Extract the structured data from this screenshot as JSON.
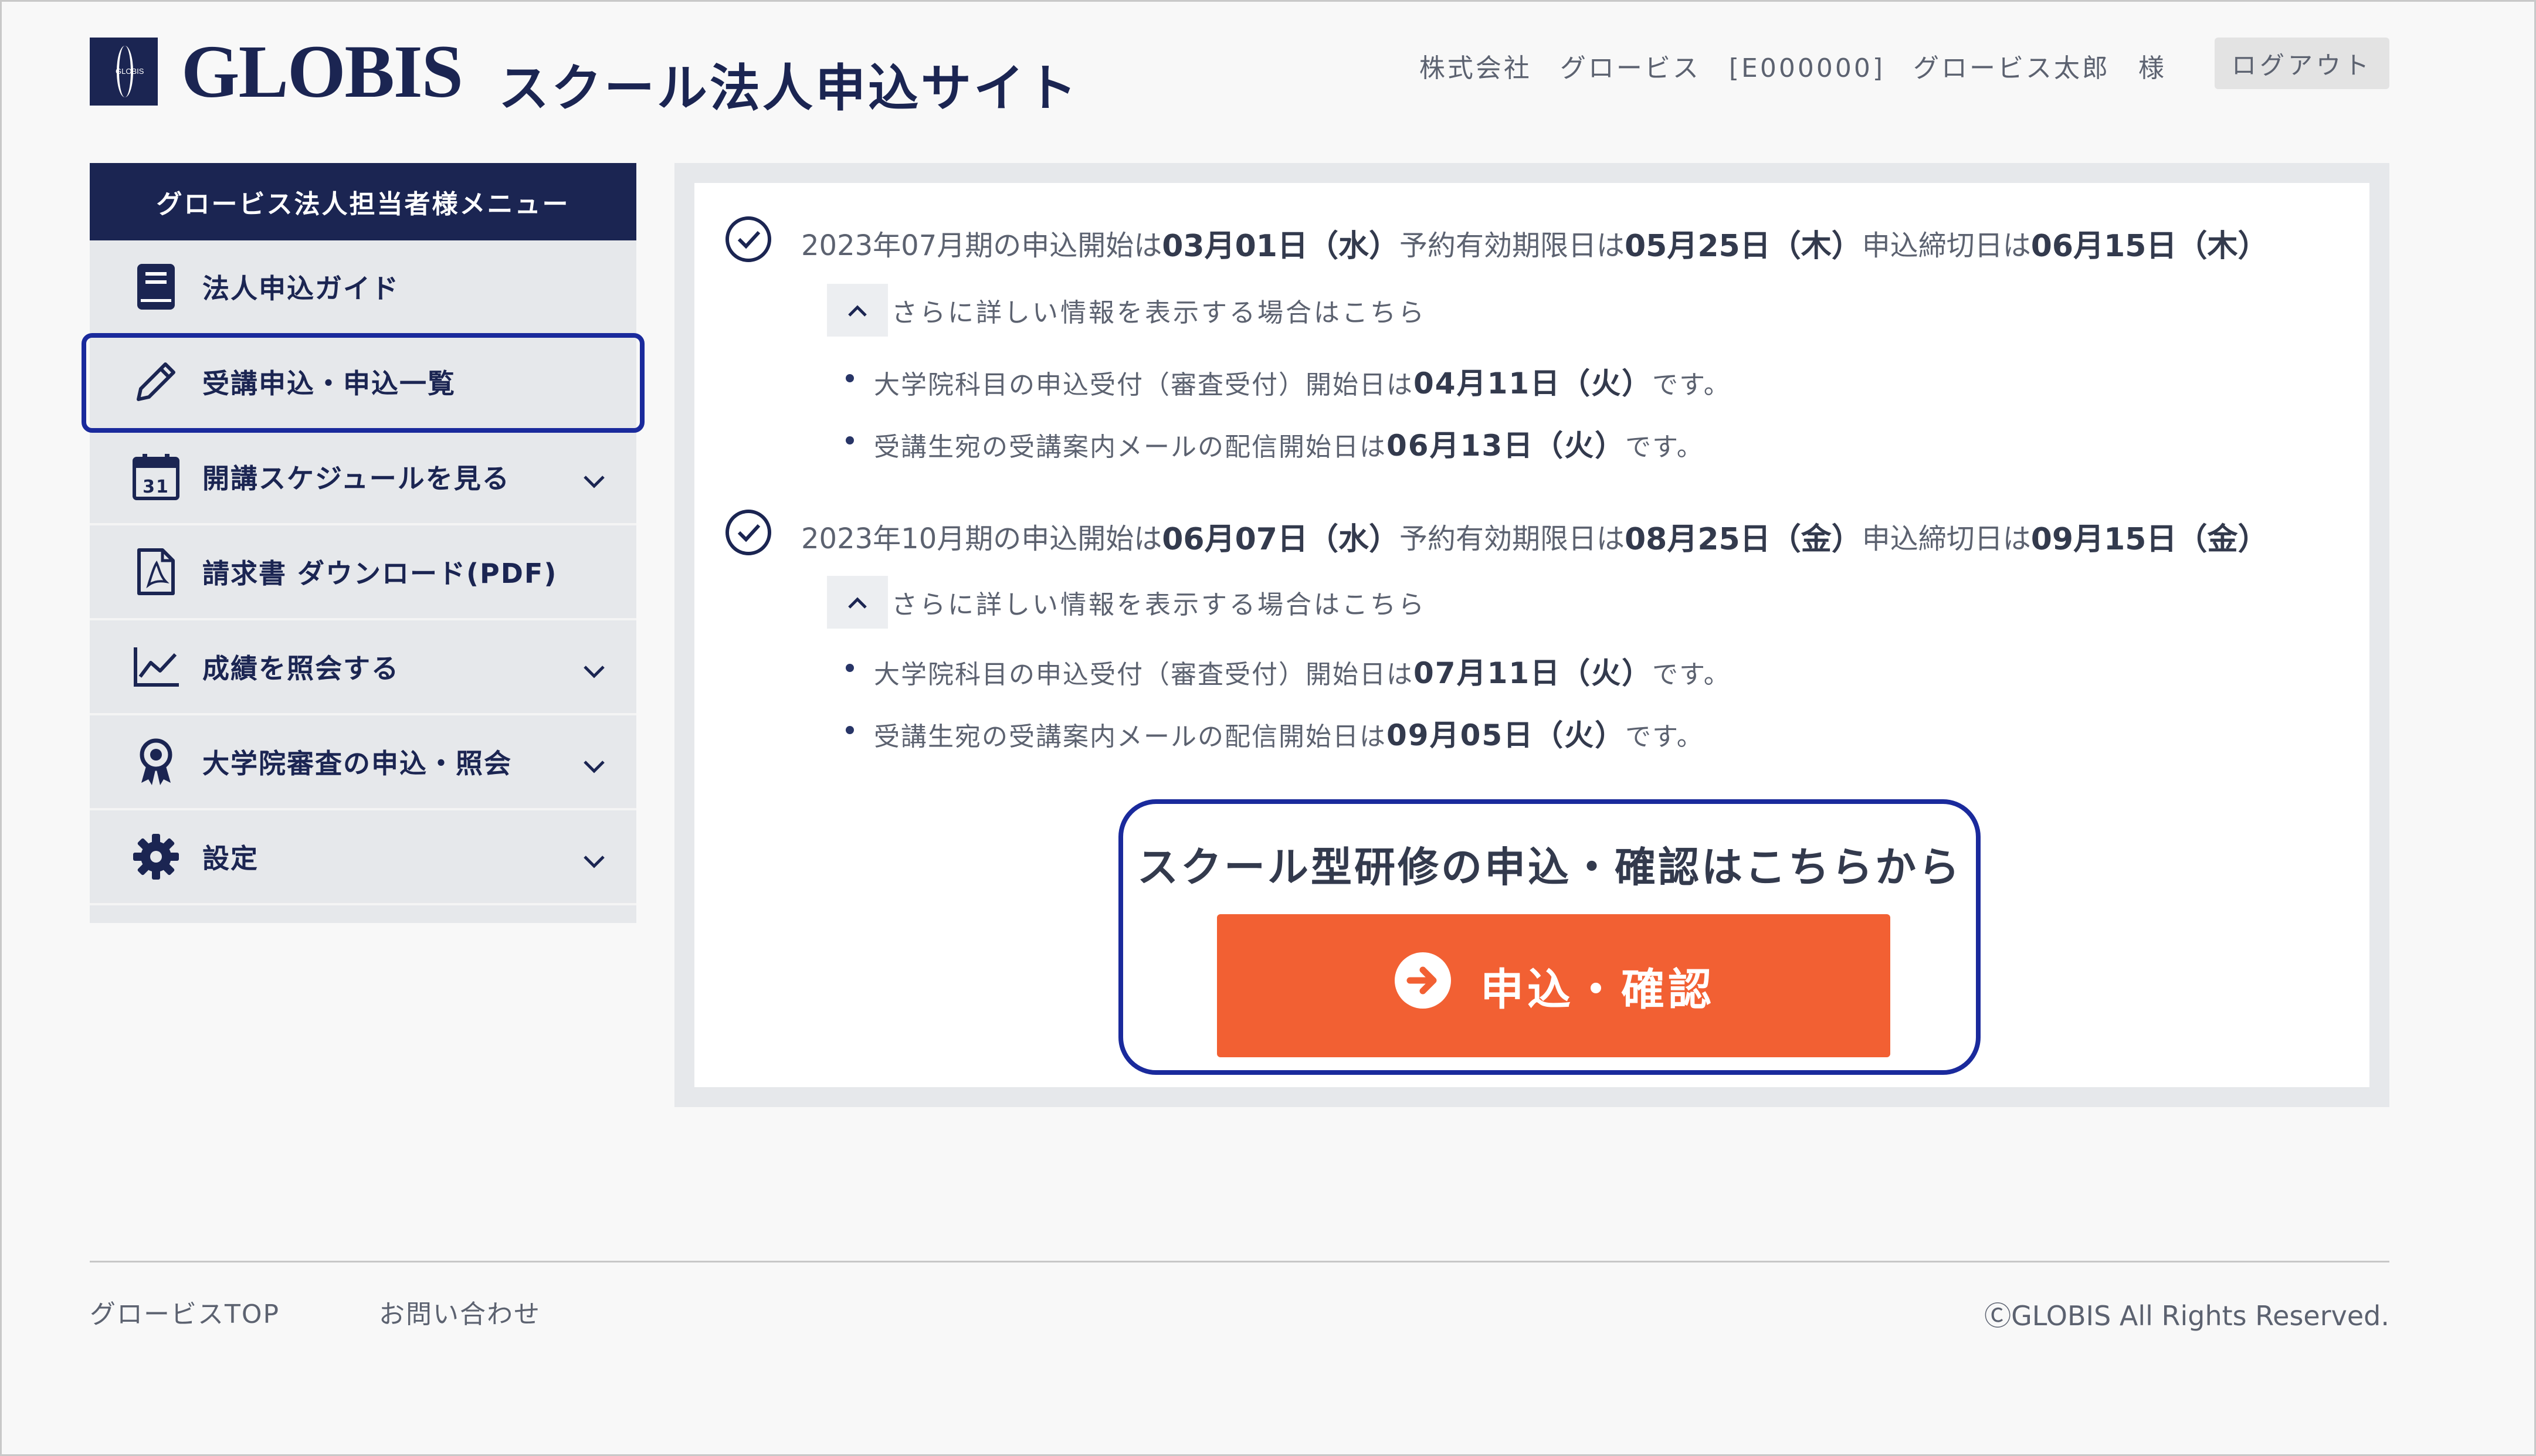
{
  "header": {
    "logo_text": "GLOBIS",
    "logo_mark_text": "GLOBIS",
    "site_title": "スクール法人申込サイト",
    "user_info": "株式会社　グロービス　[E000000]　グロービス太郎　様",
    "logout_label": "ログアウト"
  },
  "sidebar": {
    "title": "グロービス法人担当者様メニュー",
    "items": [
      {
        "label": "法人申込ガイド",
        "icon": "book-icon",
        "has_chevron": false
      },
      {
        "label": "受講申込・申込一覧",
        "icon": "pencil-icon",
        "has_chevron": false,
        "active": true
      },
      {
        "label": "開講スケジュールを見る",
        "icon": "calendar-icon",
        "calendar_day": "31",
        "has_chevron": true
      },
      {
        "label": "請求書 ダウンロード(PDF)",
        "icon": "pdf-icon",
        "has_chevron": false
      },
      {
        "label": "成績を照会する",
        "icon": "chart-line-icon",
        "has_chevron": true
      },
      {
        "label": "大学院審査の申込・照会",
        "icon": "award-icon",
        "has_chevron": true
      },
      {
        "label": "設定",
        "icon": "gear-icon",
        "has_chevron": true
      }
    ]
  },
  "periods": [
    {
      "prefix": "2023年07月期の申込開始は",
      "start": "03月01日（水）",
      "mid1": "予約有効期限日は",
      "expiry": "05月25日（木）",
      "mid2": "申込締切日は",
      "deadline": "06月15日（木）",
      "more_label": "さらに詳しい情報を表示する場合はこちら",
      "details": [
        {
          "text": "大学院科目の申込受付（審査受付）開始日は",
          "date": "04月11日（火）",
          "suffix": "です。"
        },
        {
          "text": "受講生宛の受講案内メールの配信開始日は",
          "date": "06月13日（火）",
          "suffix": "です。"
        }
      ]
    },
    {
      "prefix": "2023年10月期の申込開始は",
      "start": "06月07日（水）",
      "mid1": "予約有効期限日は",
      "expiry": "08月25日（金）",
      "mid2": "申込締切日は",
      "deadline": "09月15日（金）",
      "more_label": "さらに詳しい情報を表示する場合はこちら",
      "details": [
        {
          "text": "大学院科目の申込受付（審査受付）開始日は",
          "date": "07月11日（火）",
          "suffix": "です。"
        },
        {
          "text": "受講生宛の受講案内メールの配信開始日は",
          "date": "09月05日（火）",
          "suffix": "です。"
        }
      ]
    }
  ],
  "cta": {
    "title": "スクール型研修の申込・確認はこちらから",
    "button_label": "申込・確認"
  },
  "footer": {
    "links": [
      "グロービスTOP",
      "お問い合わせ"
    ],
    "copyright": "ⒸGLOBIS All Rights Reserved."
  },
  "colors": {
    "navy": "#1b2552",
    "orange": "#f26033",
    "highlight": "#1a2a9c"
  }
}
